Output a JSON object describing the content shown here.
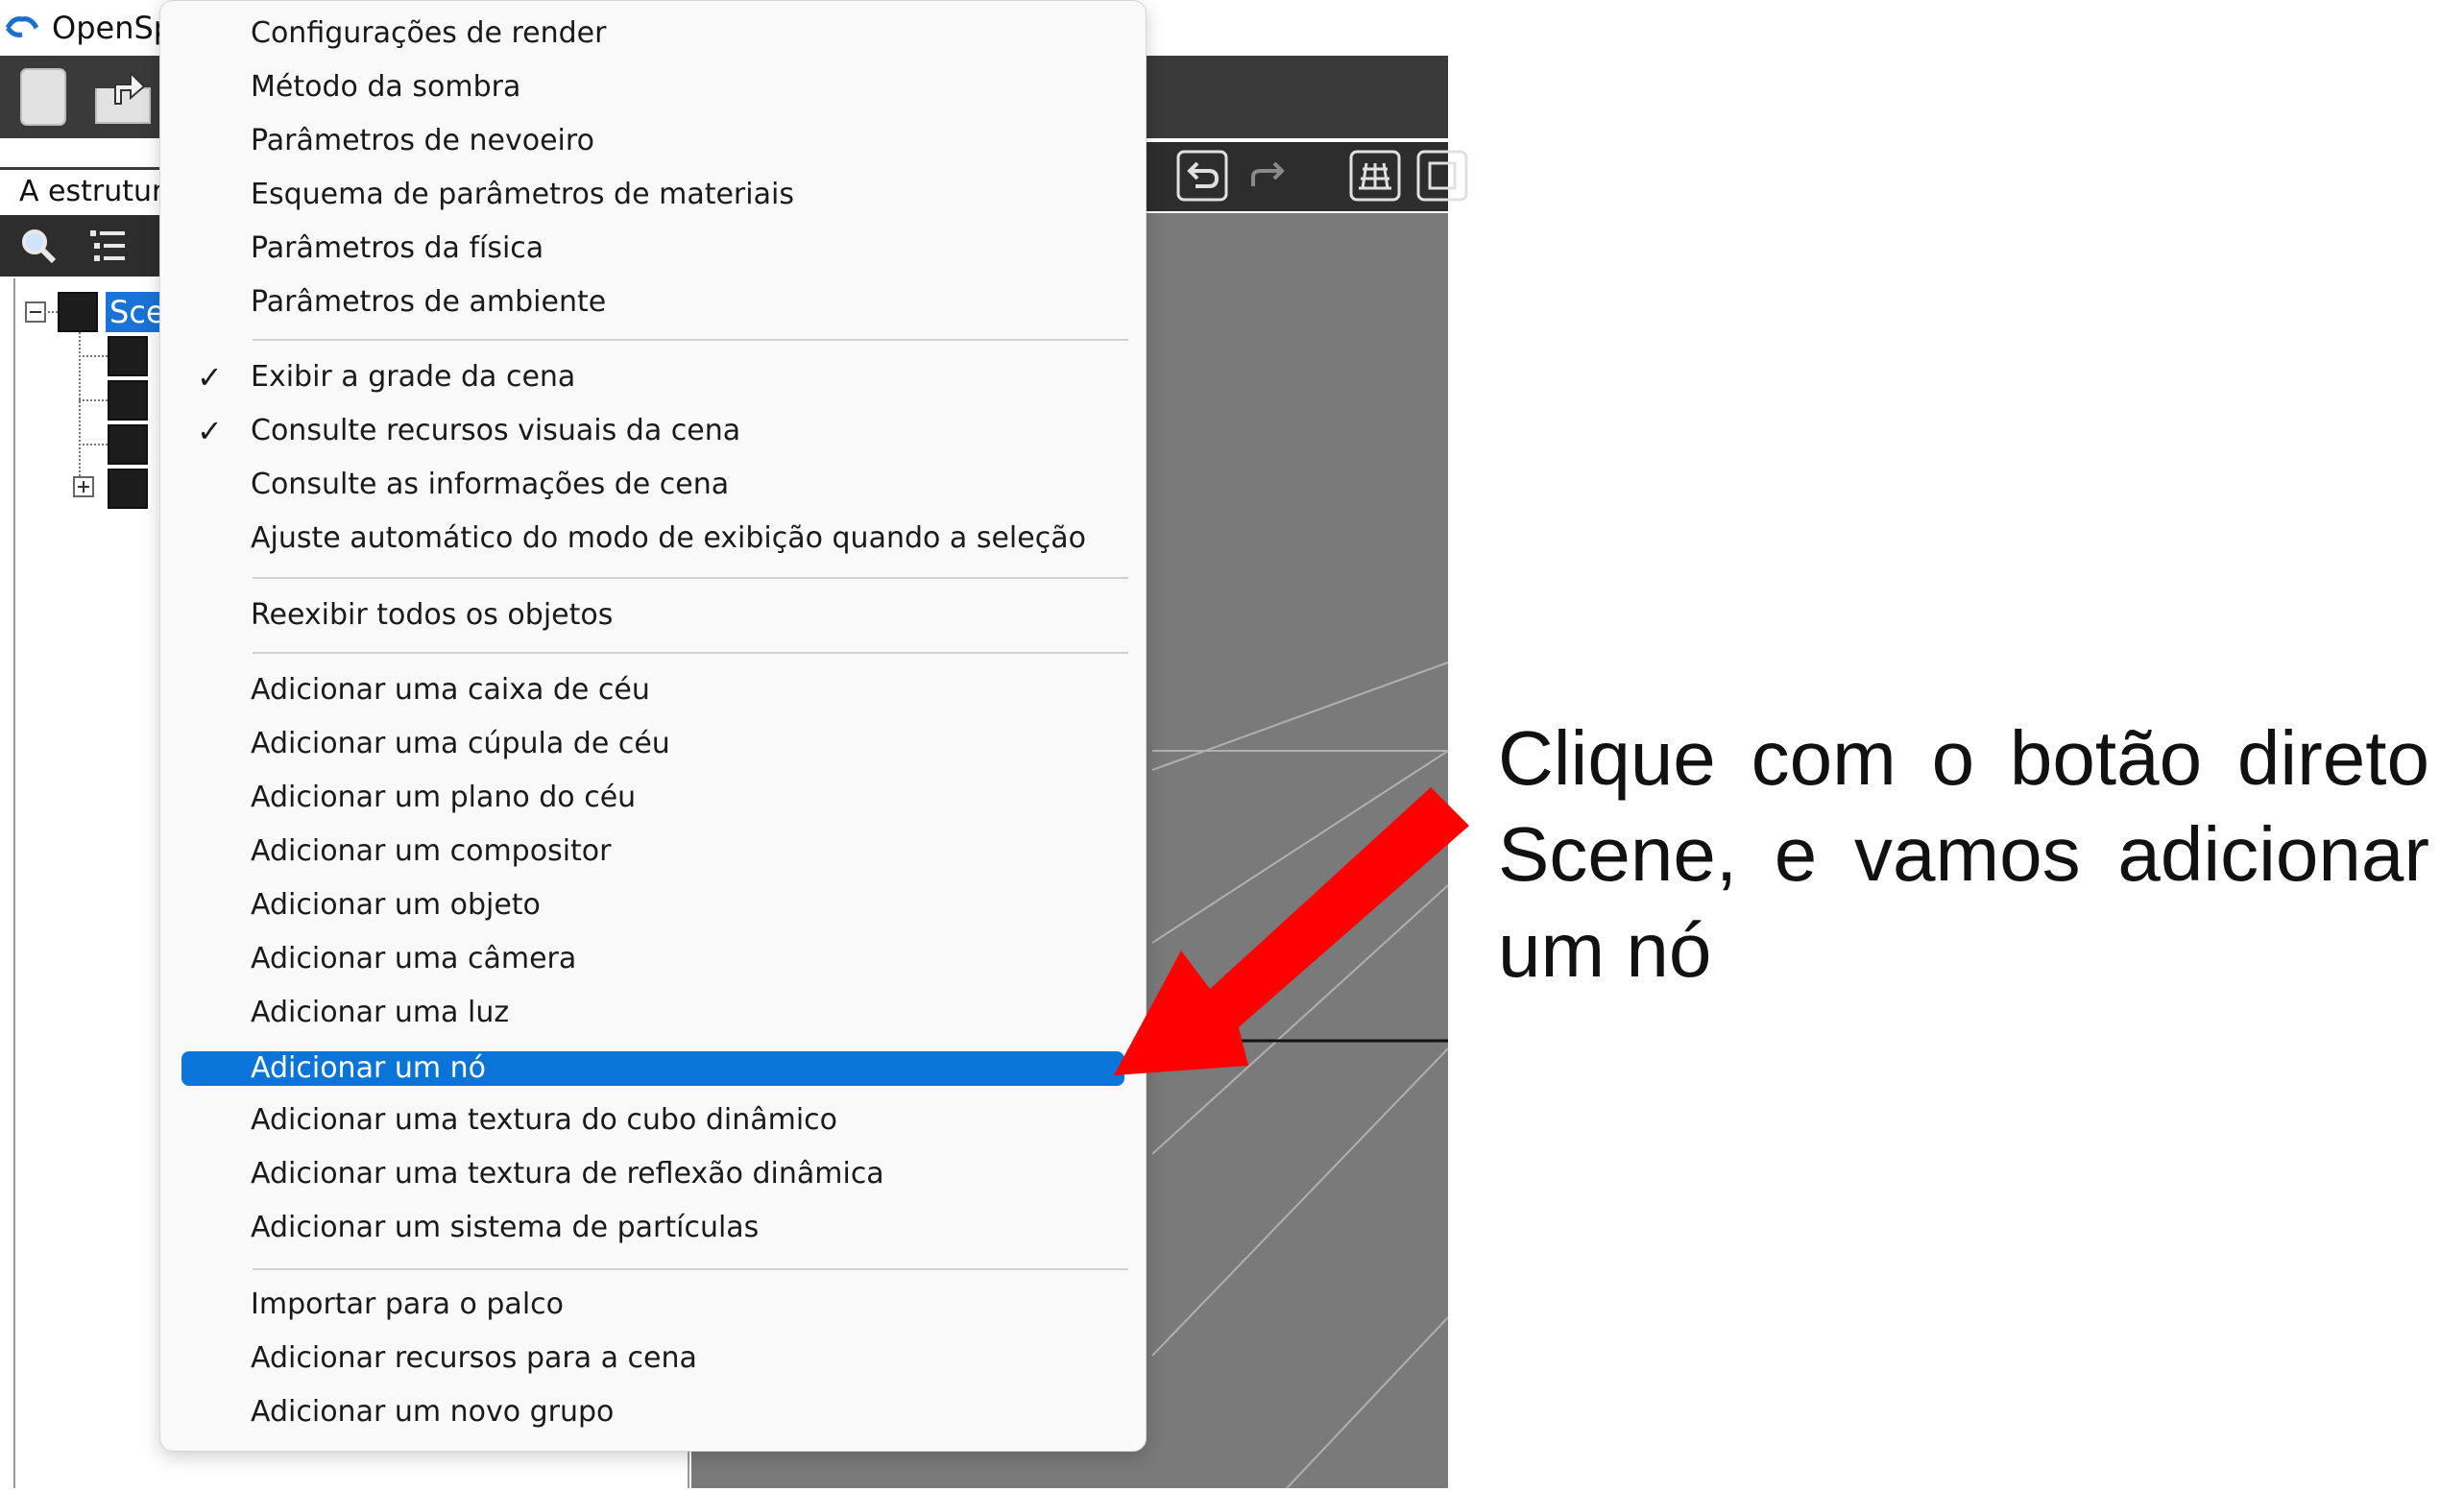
{
  "app": {
    "title": "OpenSp",
    "panel_tab": "A estrutura",
    "tree_root_label": "Sce"
  },
  "icons": {
    "logo": "opensp-logo-icon",
    "new": "new-document-icon",
    "open": "open-folder-icon",
    "search": "search-icon",
    "list": "list-icon",
    "undo": "undo-icon",
    "redo": "redo-icon",
    "grid": "grid-icon",
    "frame": "frame-icon"
  },
  "colors": {
    "highlight": "#0a74d8",
    "toolbar": "#3a3a3a",
    "viewport": "#7a7a7a",
    "arrow": "#ff0000"
  },
  "context_menu": {
    "items": [
      {
        "label": "Configurações de render",
        "checked": false
      },
      {
        "label": "Método da sombra",
        "checked": false
      },
      {
        "label": "Parâmetros de nevoeiro",
        "checked": false
      },
      {
        "label": "Esquema de parâmetros de materiais",
        "checked": false
      },
      {
        "label": "Parâmetros da física",
        "checked": false
      },
      {
        "label": "Parâmetros de ambiente",
        "checked": false
      },
      {
        "label": "Exibir a grade da cena",
        "checked": true
      },
      {
        "label": "Consulte recursos visuais da cena",
        "checked": true
      },
      {
        "label": "Consulte as informações de cena",
        "checked": false
      },
      {
        "label": "Ajuste automático do modo de exibição quando a seleção",
        "checked": false
      },
      {
        "label": "Reexibir todos os objetos",
        "checked": false
      },
      {
        "label": "Adicionar uma caixa de céu",
        "checked": false
      },
      {
        "label": "Adicionar uma cúpula de céu",
        "checked": false
      },
      {
        "label": "Adicionar um plano do céu",
        "checked": false
      },
      {
        "label": "Adicionar um compositor",
        "checked": false
      },
      {
        "label": "Adicionar um objeto",
        "checked": false
      },
      {
        "label": "Adicionar uma câmera",
        "checked": false
      },
      {
        "label": "Adicionar uma luz",
        "checked": false
      },
      {
        "label": "Adicionar um nó",
        "checked": false,
        "highlighted": true
      },
      {
        "label": "Adicionar uma textura do cubo dinâmico",
        "checked": false
      },
      {
        "label": "Adicionar uma textura de reflexão dinâmica",
        "checked": false
      },
      {
        "label": "Adicionar um sistema de partículas",
        "checked": false
      },
      {
        "label": "Importar para o palco",
        "checked": false
      },
      {
        "label": "Adicionar recursos para a cena",
        "checked": false
      },
      {
        "label": "Adicionar um novo grupo",
        "checked": false
      }
    ],
    "check_glyph": "✓"
  },
  "annotation": {
    "text": "Clique com o botão direto Scene, e vamos adicionar um nó"
  }
}
